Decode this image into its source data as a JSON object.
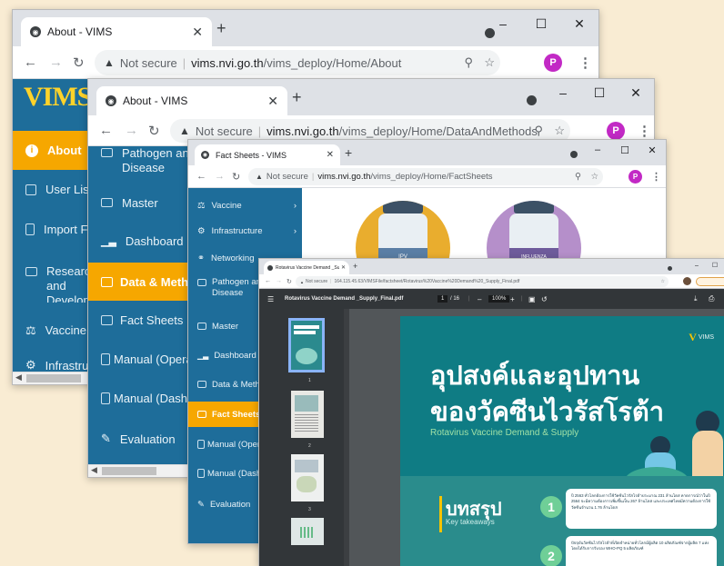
{
  "browser1": {
    "tab_title": "About - VIMS",
    "security": "Not secure",
    "url_domain": "vims.nvi.go.th",
    "url_path": "/vims_deploy/Home/About",
    "profile_initial": "P",
    "logo_text": "VIMS",
    "sidebar": [
      "About",
      "User List",
      "Import File",
      "Research and Development",
      "Vaccine",
      "Infrastructure"
    ]
  },
  "browser2": {
    "tab_title": "About - VIMS",
    "security": "Not secure",
    "url_domain": "vims.nvi.go.th",
    "url_path": "/vims_deploy/Home/DataAndMethods",
    "profile_initial": "P",
    "sidebar": [
      "Pathogen and Disease",
      "Master",
      "Dashboard",
      "Data & Methods",
      "Fact Sheets",
      "Manual (Operation)",
      "Manual (Dashboard)",
      "Evaluation"
    ]
  },
  "browser3": {
    "tab_title": "Fact Sheets - VIMS",
    "security": "Not secure",
    "url_domain": "vims.nvi.go.th",
    "url_path": "/vims_deploy/Home/FactSheets",
    "profile_initial": "P",
    "sidebar": [
      "Vaccine",
      "Infrastructure",
      "Networking",
      "Pathogen and Disease",
      "Master",
      "Dashboard",
      "Data & Methods",
      "Fact Sheets",
      "Manual (Operation)",
      "Manual (Dashboard)",
      "Evaluation"
    ],
    "vial_labels": [
      "IPV",
      "INFLUENZA"
    ]
  },
  "browser4": {
    "tab_title": "Rotavirus Vaccine Demand _Sup",
    "security": "Not secure",
    "url": "164.115.45.63/VIMSFile/factsheet/Rotavirus%20Vaccine%20Demand%20_Supply_Final.pdf",
    "pdf_title": "Rotavirus Vaccine Demand _Supply_Final.pdf",
    "page_current": "1",
    "page_total": "/ 16",
    "zoom": "100%",
    "thumb_numbers": [
      "1",
      "2",
      "3"
    ],
    "doc_logo": "VIMS",
    "doc_title_th_1": "อุปสงค์และอุปทาน",
    "doc_title_th_2": "ของวัคซีนไวรัสโรต้า",
    "doc_subtitle_en": "Rotavirus Vaccine Demand & Supply",
    "summary_th": "บทสรุป",
    "summary_en": "Key takeaways",
    "takeaway_1": "ปี 2563 ทั่วโลกต้องการใช้วัคซีนไวรัสโรต้าประมาณ 231 ล้านโดส คาดการณ์ว่าในปี 2564 จะมีความต้องการเพิ่มขึ้นเป็น 267 ล้านโดส และประเทศไทยมีความต้องการใช้วัคซีนจำนวน 1.76 ล้านโดส",
    "takeaway_2": "ปัจจุบันวัคซีนไวรัสโรต้าที่เปิดจำหน่ายทั่วโลกมีผู้ผลิต 10 ผลิตภัณฑ์จากผู้ผลิต 7 แห่ง โดยได้รับการรับรอง WHO-PQ 5 ผลิตภัณฑ์",
    "num_1": "1",
    "num_2": "2"
  },
  "colors": {
    "sidebar": "#1e6d9a",
    "active": "#f6a700",
    "pdf_bg": "#525659",
    "pdf_toolbar": "#323639",
    "doc_teal": "#0f7c84"
  }
}
